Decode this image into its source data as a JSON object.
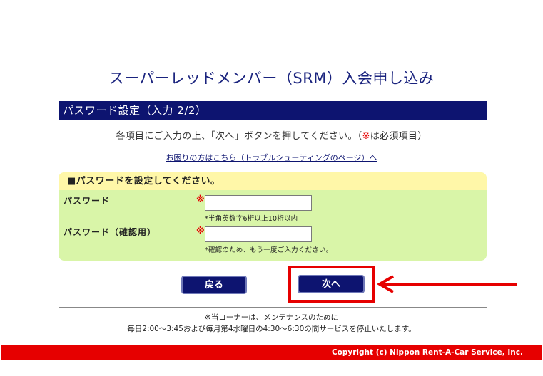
{
  "page": {
    "title": "スーパーレッドメンバー（SRM）入会申し込み"
  },
  "section": {
    "header": "パスワード設定（入力 2/2）",
    "instruction_before": "各項目にご入力の上、「次へ」ボタンを押してください。（",
    "required_mark": "※",
    "instruction_after": "は必須項目）",
    "help_link": "お困りの方はこちら（トラブルシューティングのページ）へ"
  },
  "form": {
    "header": "■パスワードを設定してください。",
    "password": {
      "label": "パスワード",
      "required_mark": "※",
      "value": "",
      "hint": "*半角英数字6桁以上10桁以内"
    },
    "password_confirm": {
      "label": "パスワード（確認用）",
      "required_mark": "※",
      "value": "",
      "hint": "*確認のため、もう一度ご入力ください。"
    }
  },
  "buttons": {
    "back_label": "戻る",
    "next_label": "次へ"
  },
  "notice": {
    "line1": "※当コーナーは、メンテナンスのために",
    "line2": "毎日2:00～3:45および毎月第4水曜日の4:30～6:30の間サービスを停止いたします。"
  },
  "footer": {
    "copyright": "Copyright (c) Nippon Rent-A-Car Service, Inc."
  },
  "colors": {
    "navy": "#0d1470",
    "red": "#e60000",
    "form_green": "#d9f5a8",
    "form_yellow": "#fff7a8"
  },
  "icons": {
    "annotation": "arrow-left-icon"
  }
}
